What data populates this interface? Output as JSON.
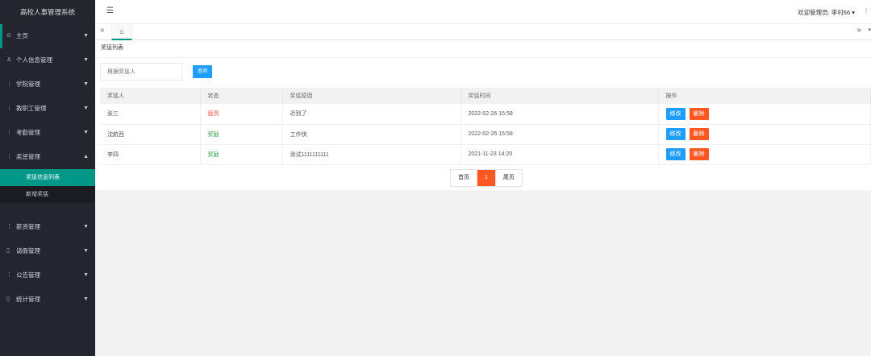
{
  "sidebar": {
    "logo": "高校人事管理系统",
    "items": [
      {
        "icon": "⊙",
        "label": "主页"
      },
      {
        "icon": "♙",
        "label": "个人信息管理"
      },
      {
        "icon": "⋮",
        "label": "学院管理"
      },
      {
        "icon": "⋮",
        "label": "教职工管理"
      },
      {
        "icon": "⋮",
        "label": "考勤管理"
      },
      {
        "icon": "⋮",
        "label": "奖惩管理"
      },
      {
        "icon": "⋮",
        "label": "薪资管理"
      },
      {
        "icon": "▯",
        "label": "请假管理"
      },
      {
        "icon": "⋮",
        "label": "公告管理"
      },
      {
        "icon": "▯",
        "label": "统计管理"
      }
    ],
    "sub_items": [
      {
        "label": "奖惩信息列表"
      },
      {
        "label": "新增奖惩"
      }
    ]
  },
  "header": {
    "user": "欢迎管理员: 李村66"
  },
  "tabs": {
    "left_icon": "«",
    "home_icon": "⌂",
    "right_icon": "»"
  },
  "card": {
    "title": "奖惩列表",
    "search_placeholder": "根据奖惩人",
    "search_button": "查询"
  },
  "table": {
    "columns": [
      "奖惩人",
      "状态",
      "奖惩原因",
      "奖惩时间",
      "操作"
    ],
    "rows": [
      {
        "person": "张三",
        "status": "惩罚",
        "reason": "迟到了",
        "time": "2022-02-26 15:58"
      },
      {
        "person": "沈航西",
        "status": "奖励",
        "reason": "工作快",
        "time": "2022-02-26 15:58"
      },
      {
        "person": "李四",
        "status": "奖励",
        "reason": "测试1111111111",
        "time": "2021-11-23 14:20"
      }
    ],
    "edit_label": "修改",
    "delete_label": "删除"
  },
  "pager": {
    "first": "首页",
    "current": "1",
    "last": "尾页"
  },
  "colors": {
    "accent": "#009688",
    "primary_button": "#1e9fff",
    "danger_button": "#ff5722",
    "sidebar_bg": "#23262e"
  }
}
